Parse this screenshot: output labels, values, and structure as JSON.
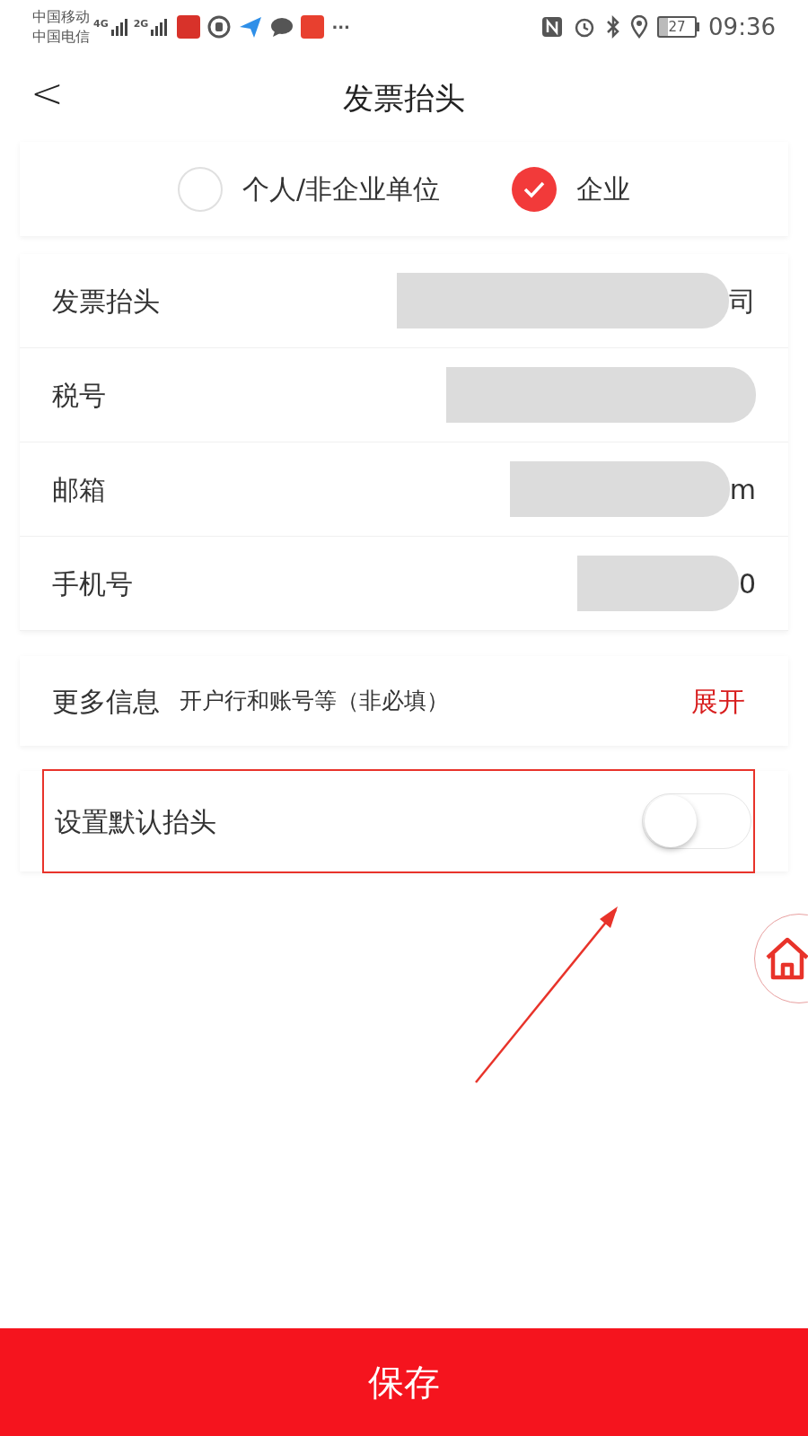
{
  "status_bar": {
    "carriers": [
      "中国移动",
      "中国电信"
    ],
    "networks": [
      "4G",
      "2G"
    ],
    "more": "···",
    "battery": "27",
    "time": "09:36"
  },
  "header": {
    "back": "<",
    "title": "发票抬头"
  },
  "type_options": [
    {
      "label": "个人/非企业单位",
      "selected": false
    },
    {
      "label": "企业",
      "selected": true
    }
  ],
  "fields": [
    {
      "label": "发票抬头",
      "value_tail": "司"
    },
    {
      "label": "税号"
    },
    {
      "label": "邮箱",
      "value_tail": "m"
    },
    {
      "label": "手机号",
      "value_tail": "0"
    }
  ],
  "more_info": {
    "label": "更多信息",
    "hint": "开户行和账号等（非必填）",
    "action": "展开"
  },
  "default_title": {
    "label": "设置默认抬头",
    "on": false
  },
  "save_button": "保存"
}
